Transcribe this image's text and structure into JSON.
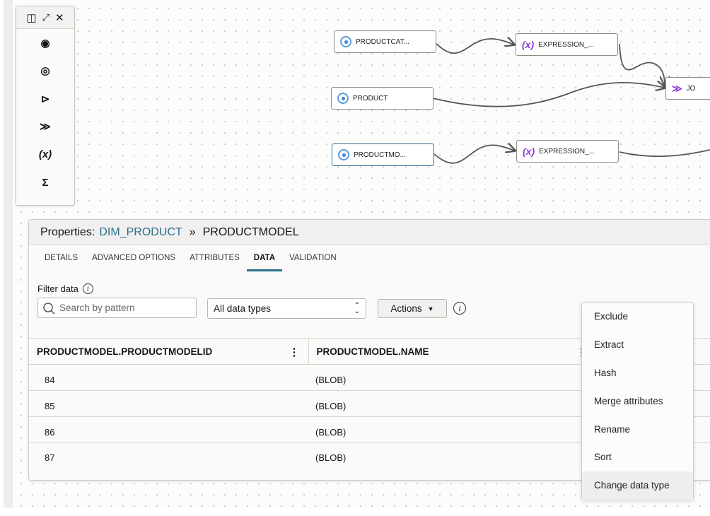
{
  "palette": {
    "header_icons": [
      "panel-icon",
      "expand-icon",
      "close-icon"
    ],
    "tools": [
      {
        "icon": "source-icon",
        "glyph": "◉"
      },
      {
        "icon": "target-icon",
        "glyph": "◎"
      },
      {
        "icon": "filter-icon",
        "glyph": "⊳"
      },
      {
        "icon": "join-icon",
        "glyph": "≫"
      },
      {
        "icon": "expression-icon",
        "glyph": "(x)"
      },
      {
        "icon": "aggregate-icon",
        "glyph": "Σ"
      }
    ]
  },
  "nodes": [
    {
      "label": "PRODUCTCAT...",
      "type": "source"
    },
    {
      "label": "EXPRESSION_...",
      "type": "expression"
    },
    {
      "label": "PRODUCT",
      "type": "source"
    },
    {
      "label": "JO",
      "type": "join"
    },
    {
      "label": "PRODUCTMO...",
      "type": "source"
    },
    {
      "label": "EXPRESSION_...",
      "type": "expression"
    }
  ],
  "properties": {
    "prefix": "Properties:",
    "link": "DIM_PRODUCT",
    "sep": "»",
    "current": "PRODUCTMODEL",
    "tabs": [
      "DETAILS",
      "ADVANCED OPTIONS",
      "ATTRIBUTES",
      "DATA",
      "VALIDATION"
    ],
    "active_tab": "DATA",
    "filter_label": "Filter data",
    "search_placeholder": "Search by pattern",
    "type_select": "All data types",
    "actions_label": "Actions",
    "columns": [
      "PRODUCTMODEL.PRODUCTMODELID",
      "PRODUCTMODEL.NAME"
    ],
    "rows": [
      [
        "84",
        "(BLOB)"
      ],
      [
        "85",
        "(BLOB)"
      ],
      [
        "86",
        "(BLOB)"
      ],
      [
        "87",
        "(BLOB)"
      ]
    ]
  },
  "menu": {
    "items": [
      "Exclude",
      "Extract",
      "Hash",
      "Merge attributes",
      "Rename",
      "Sort",
      "Change data type"
    ],
    "hovered": "Change data type"
  },
  "colors": {
    "accent": "#2a6f91",
    "expression": "#8a3fd6",
    "source": "#3d85d8"
  }
}
